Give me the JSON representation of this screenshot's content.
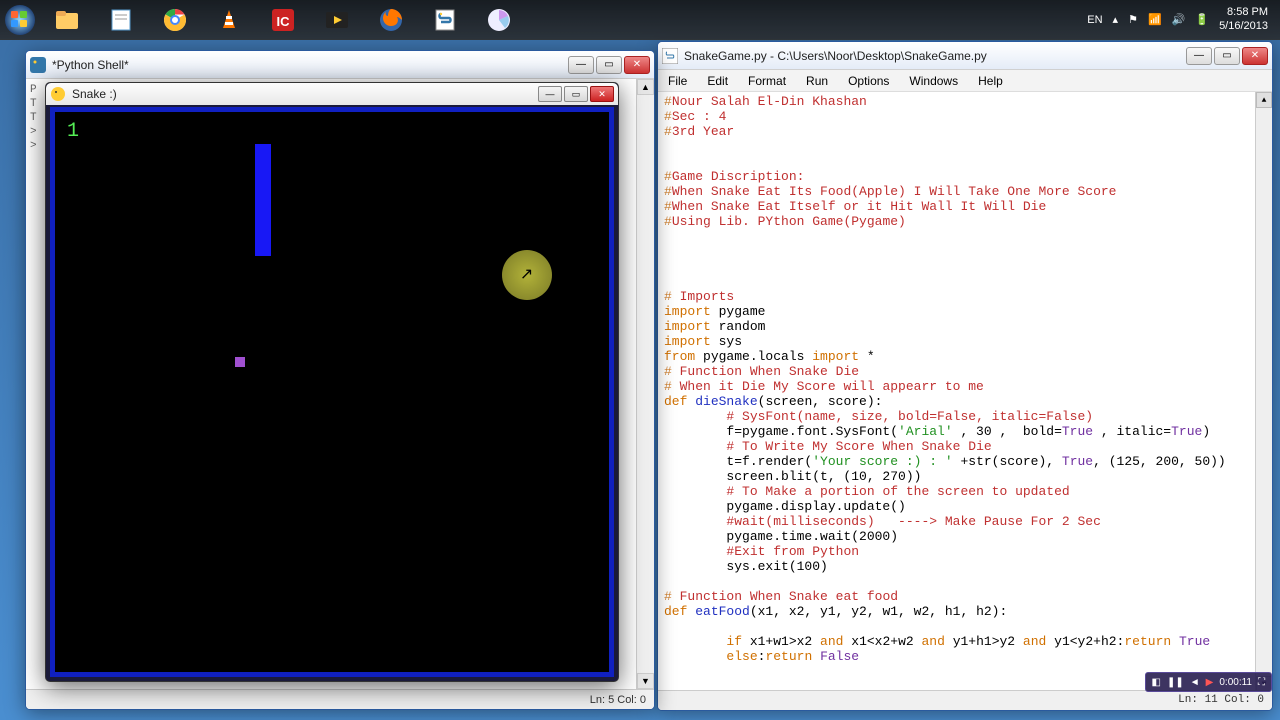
{
  "taskbar": {
    "lang": "EN",
    "time": "8:58 PM",
    "date": "5/16/2013"
  },
  "shell": {
    "title": "*Python Shell*",
    "status_ln": "Ln: 5",
    "status_col": "Col: 0"
  },
  "game": {
    "title": "Snake :)",
    "score": "1"
  },
  "idle": {
    "title": "SnakeGame.py - C:\\Users\\Noor\\Desktop\\SnakeGame.py",
    "menu": [
      "File",
      "Edit",
      "Format",
      "Run",
      "Options",
      "Windows",
      "Help"
    ],
    "status_ln": "Ln: 11",
    "status_col": "Col: 0",
    "code_lines": [
      {
        "parts": [
          [
            "o",
            "#"
          ],
          [
            "c",
            "Nour Salah El-Din Khashan"
          ]
        ]
      },
      {
        "parts": [
          [
            "o",
            "#"
          ],
          [
            "c",
            "Sec : 4"
          ]
        ]
      },
      {
        "parts": [
          [
            "o",
            "#"
          ],
          [
            "c",
            "3rd Year"
          ]
        ]
      },
      {
        "parts": []
      },
      {
        "parts": []
      },
      {
        "parts": [
          [
            "o",
            "#"
          ],
          [
            "c",
            "Game Discription:"
          ]
        ]
      },
      {
        "parts": [
          [
            "o",
            "#"
          ],
          [
            "c",
            "When Snake Eat Its Food(Apple) I Will Take One More Score"
          ]
        ]
      },
      {
        "parts": [
          [
            "o",
            "#"
          ],
          [
            "c",
            "When Snake Eat Itself or it Hit Wall It Will Die"
          ]
        ]
      },
      {
        "parts": [
          [
            "o",
            "#"
          ],
          [
            "c",
            "Using Lib. PYthon Game(Pygame)"
          ]
        ]
      },
      {
        "parts": []
      },
      {
        "parts": []
      },
      {
        "parts": []
      },
      {
        "parts": []
      },
      {
        "parts": [
          [
            "o",
            "#"
          ],
          [
            "c",
            " Imports"
          ]
        ]
      },
      {
        "parts": [
          [
            "k",
            "import "
          ],
          [
            "n",
            "pygame"
          ]
        ]
      },
      {
        "parts": [
          [
            "k",
            "import "
          ],
          [
            "n",
            "random"
          ]
        ]
      },
      {
        "parts": [
          [
            "k",
            "import "
          ],
          [
            "n",
            "sys"
          ]
        ]
      },
      {
        "parts": [
          [
            "k",
            "from "
          ],
          [
            "n",
            "pygame.locals "
          ],
          [
            "k",
            "import "
          ],
          [
            "n",
            "*"
          ]
        ]
      },
      {
        "parts": [
          [
            "o",
            "#"
          ],
          [
            "c",
            " Function When Snake Die"
          ]
        ]
      },
      {
        "parts": [
          [
            "o",
            "#"
          ],
          [
            "c",
            " When it Die My Score will appearr to me"
          ]
        ]
      },
      {
        "parts": [
          [
            "k",
            "def "
          ],
          [
            "f",
            "dieSnake"
          ],
          [
            "n",
            "(screen, score):"
          ]
        ]
      },
      {
        "parts": [
          [
            "n",
            "        "
          ],
          [
            "c",
            "# SysFont(name, size, bold=False, italic=False)"
          ]
        ]
      },
      {
        "parts": [
          [
            "n",
            "        f=pygame.font.SysFont("
          ],
          [
            "s",
            "'Arial'"
          ],
          [
            "n",
            " , 30 ,  bold="
          ],
          [
            "p",
            "True"
          ],
          [
            "n",
            " , italic="
          ],
          [
            "p",
            "True"
          ],
          [
            "n",
            ")"
          ]
        ]
      },
      {
        "parts": [
          [
            "n",
            "        "
          ],
          [
            "c",
            "# To Write My Score When Snake Die"
          ]
        ]
      },
      {
        "parts": [
          [
            "n",
            "        t=f.render("
          ],
          [
            "s",
            "'Your score :) : '"
          ],
          [
            "n",
            " +str(score), "
          ],
          [
            "p",
            "True"
          ],
          [
            "n",
            ", (125, 200, 50))"
          ]
        ]
      },
      {
        "parts": [
          [
            "n",
            "        screen.blit(t, (10, 270))"
          ]
        ]
      },
      {
        "parts": [
          [
            "n",
            "        "
          ],
          [
            "c",
            "# To Make a portion of the screen to updated"
          ]
        ]
      },
      {
        "parts": [
          [
            "n",
            "        pygame.display.update()"
          ]
        ]
      },
      {
        "parts": [
          [
            "n",
            "        "
          ],
          [
            "c",
            "#wait(milliseconds)   ----> Make Pause For 2 Sec"
          ]
        ]
      },
      {
        "parts": [
          [
            "n",
            "        pygame.time.wait(2000)"
          ]
        ]
      },
      {
        "parts": [
          [
            "n",
            "        "
          ],
          [
            "c",
            "#Exit from Python"
          ]
        ]
      },
      {
        "parts": [
          [
            "n",
            "        sys.exit(100)"
          ]
        ]
      },
      {
        "parts": []
      },
      {
        "parts": [
          [
            "o",
            "#"
          ],
          [
            "c",
            " Function When Snake eat food"
          ]
        ]
      },
      {
        "parts": [
          [
            "k",
            "def "
          ],
          [
            "f",
            "eatFood"
          ],
          [
            "n",
            "(x1, x2, y1, y2, w1, w2, h1, h2):"
          ]
        ]
      },
      {
        "parts": []
      },
      {
        "parts": [
          [
            "n",
            "        "
          ],
          [
            "k",
            "if "
          ],
          [
            "n",
            "x1+w1>x2 "
          ],
          [
            "k",
            "and "
          ],
          [
            "n",
            "x1<x2+w2 "
          ],
          [
            "k",
            "and "
          ],
          [
            "n",
            "y1+h1>y2 "
          ],
          [
            "k",
            "and "
          ],
          [
            "n",
            "y1<y2+h2:"
          ],
          [
            "k",
            "return "
          ],
          [
            "p",
            "True"
          ]
        ]
      },
      {
        "parts": [
          [
            "n",
            "        "
          ],
          [
            "k",
            "else"
          ],
          [
            "n",
            ":"
          ],
          [
            "k",
            "return "
          ],
          [
            "p",
            "False"
          ]
        ]
      }
    ]
  },
  "media": {
    "elapsed": "0:00:11"
  }
}
